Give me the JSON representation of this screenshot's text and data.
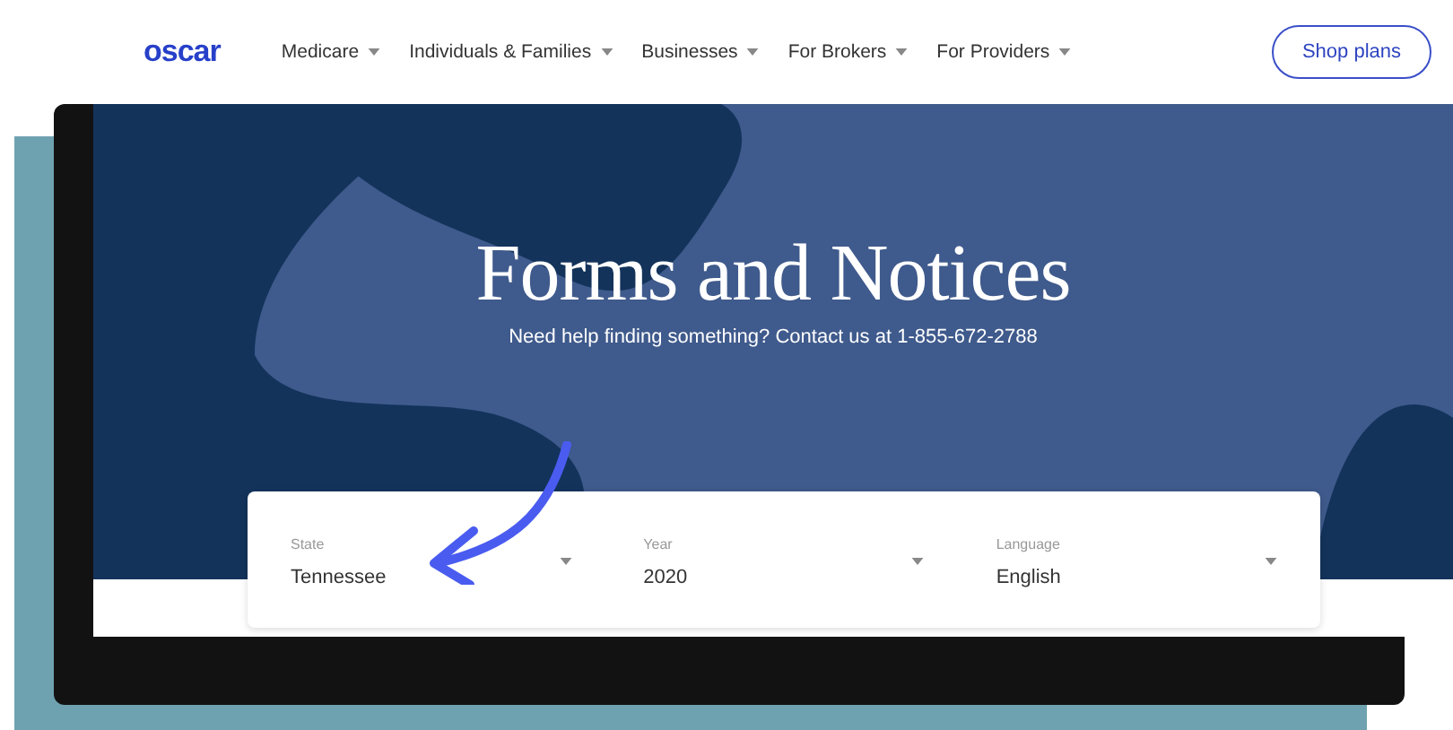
{
  "nav": {
    "logo": "oscar",
    "items": [
      {
        "label": "Medicare"
      },
      {
        "label": "Individuals & Families"
      },
      {
        "label": "Businesses"
      },
      {
        "label": "For Brokers"
      },
      {
        "label": "For Providers"
      }
    ],
    "cta": "Shop plans"
  },
  "hero": {
    "title": "Forms and Notices",
    "subtitle": "Need help finding something? Contact us at 1-855-672-2788"
  },
  "filters": [
    {
      "label": "State",
      "value": "Tennessee"
    },
    {
      "label": "Year",
      "value": "2020"
    },
    {
      "label": "Language",
      "value": "English"
    }
  ]
}
